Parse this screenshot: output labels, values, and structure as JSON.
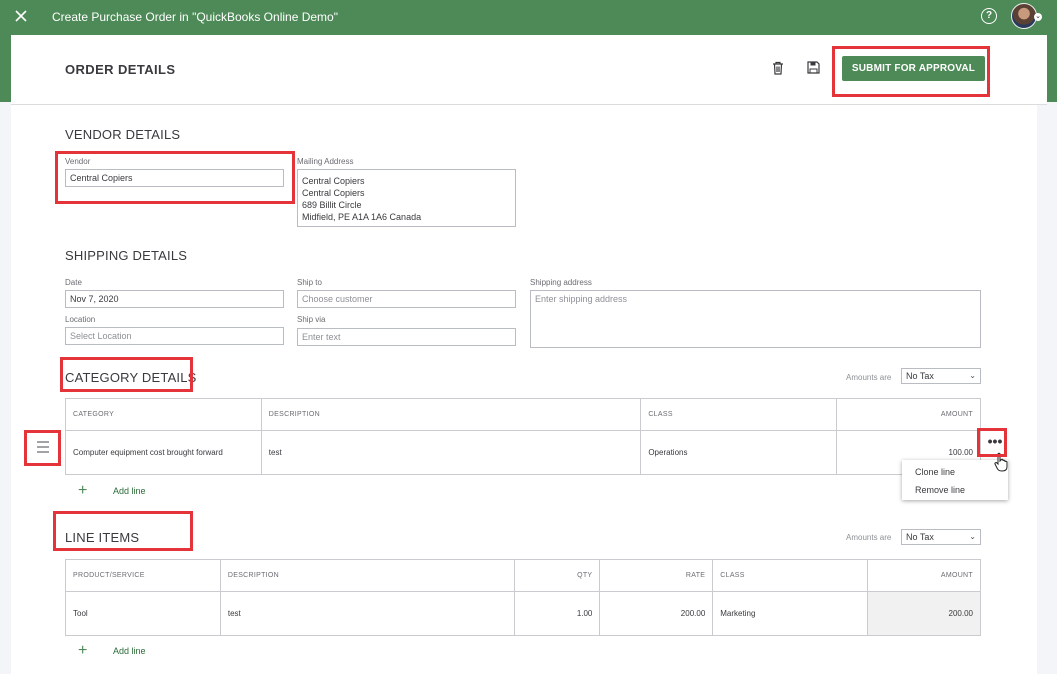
{
  "topbar": {
    "title": "Create Purchase Order in \"QuickBooks Online Demo\"",
    "help_icon": "?"
  },
  "header": {
    "title": "ORDER DETAILS",
    "submit_label": "SUBMIT FOR APPROVAL"
  },
  "vendor": {
    "section_title": "VENDOR DETAILS",
    "vendor_label": "Vendor",
    "vendor_value": "Central Copiers",
    "mailing_label": "Mailing Address",
    "mailing_lines": [
      "Central Copiers",
      "Central Copiers",
      "689 Billit Circle",
      "Midfield, PE A1A 1A6 Canada"
    ]
  },
  "shipping": {
    "section_title": "SHIPPING DETAILS",
    "date_label": "Date",
    "date_value": "Nov 7, 2020",
    "ship_to_label": "Ship to",
    "ship_to_placeholder": "Choose customer",
    "shipping_address_label": "Shipping address",
    "shipping_address_placeholder": "Enter shipping address",
    "location_label": "Location",
    "location_placeholder": "Select Location",
    "ship_via_label": "Ship via",
    "ship_via_placeholder": "Enter text"
  },
  "category": {
    "section_title": "CATEGORY DETAILS",
    "amounts_are_label": "Amounts are",
    "tax_option": "No Tax",
    "columns": [
      "CATEGORY",
      "DESCRIPTION",
      "CLASS",
      "AMOUNT"
    ],
    "row": {
      "category": "Computer equipment cost brought forward",
      "description": "test",
      "class": "Operations",
      "amount": "100.00"
    },
    "add_line": "Add line",
    "row_menu": {
      "clone": "Clone line",
      "remove": "Remove line"
    }
  },
  "line_items": {
    "section_title": "LINE ITEMS",
    "amounts_are_label": "Amounts are",
    "tax_option": "No Tax",
    "columns": [
      "PRODUCT/SERVICE",
      "DESCRIPTION",
      "QTY",
      "RATE",
      "CLASS",
      "AMOUNT"
    ],
    "row": {
      "product": "Tool",
      "description": "test",
      "qty": "1.00",
      "rate": "200.00",
      "class": "Marketing",
      "amount": "200.00"
    },
    "add_line": "Add line"
  },
  "colors": {
    "brand_green": "#4e8a57",
    "highlight_red": "#e5333a"
  }
}
